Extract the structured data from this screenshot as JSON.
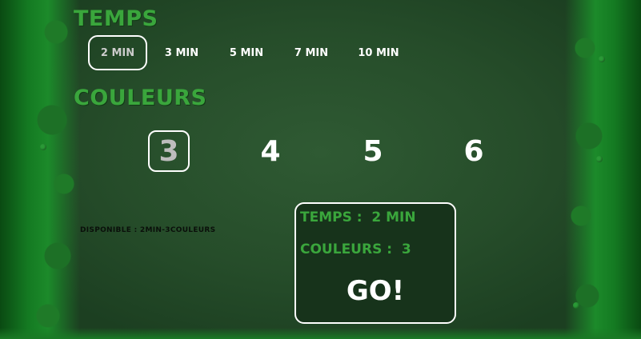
{
  "time": {
    "heading": "TEMPS",
    "options": [
      "2 MIN",
      "3 MIN",
      "5 MIN",
      "7 MIN",
      "10 MIN"
    ],
    "selected": "2 MIN"
  },
  "colors": {
    "heading": "COULEURS",
    "options": [
      "3",
      "4",
      "5",
      "6"
    ],
    "selected": "3"
  },
  "availability": "DISPONIBLE : 2MIN-3COULEURS",
  "summary": {
    "temps_label": "TEMPS :",
    "temps_value": "2 MIN",
    "couleurs_label": "COULEURS :",
    "couleurs_value": "3",
    "go_label": "GO!"
  },
  "palette": {
    "accent_green": "#3aa63c",
    "selection_border": "#ffffff",
    "background": "#264d2a"
  }
}
